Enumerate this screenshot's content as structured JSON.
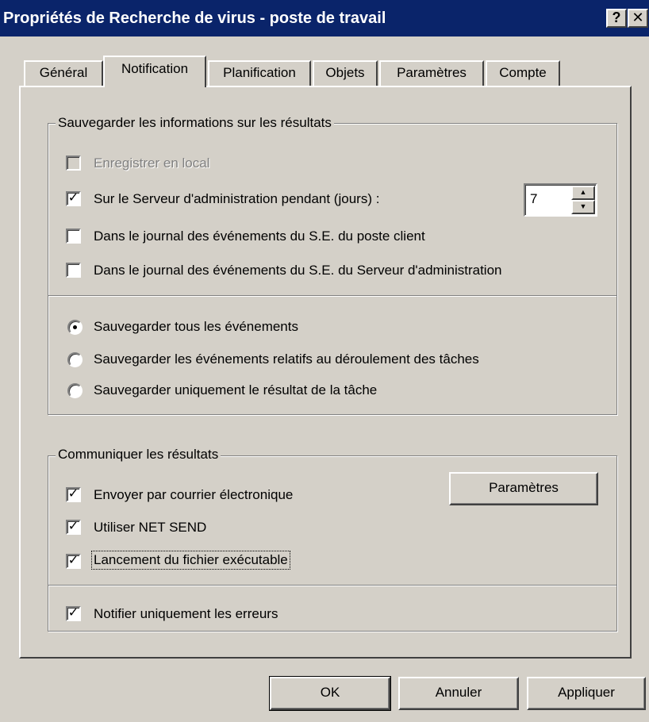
{
  "window": {
    "title": "Propriétés de Recherche de virus - poste de travail",
    "help_label": "?",
    "close_label": "✕"
  },
  "tabs": [
    {
      "label": "Général"
    },
    {
      "label": "Notification"
    },
    {
      "label": "Planification"
    },
    {
      "label": "Objets"
    },
    {
      "label": "Paramètres"
    },
    {
      "label": "Compte"
    }
  ],
  "active_tab": "Notification",
  "save_group": {
    "title": "Sauvegarder les informations sur les résultats",
    "options": [
      {
        "label": "Enregistrer en local",
        "checked": false,
        "disabled": true
      },
      {
        "label": "Sur le Serveur d'administration pendant (jours) :",
        "checked": true,
        "disabled": false
      },
      {
        "label": "Dans le journal des événements du S.E. du poste client",
        "checked": false,
        "disabled": false
      },
      {
        "label": "Dans le journal des événements du S.E. du Serveur d'administration",
        "checked": false,
        "disabled": false
      }
    ],
    "days_value": "7",
    "radios": [
      {
        "label": "Sauvegarder tous les événements",
        "selected": true
      },
      {
        "label": "Sauvegarder les événements relatifs au déroulement des tâches",
        "selected": false
      },
      {
        "label": "Sauvegarder uniquement le résultat de la tâche",
        "selected": false
      }
    ]
  },
  "notify_group": {
    "title": "Communiquer les résultats",
    "options": [
      {
        "label": "Envoyer par courrier électronique",
        "checked": true
      },
      {
        "label": "Utiliser NET SEND",
        "checked": true
      },
      {
        "label": "Lancement du fichier exécutable",
        "checked": true
      }
    ],
    "params_button": "Paramètres",
    "errors_only": {
      "label": "Notifier uniquement les erreurs",
      "checked": true
    }
  },
  "footer": {
    "ok": "OK",
    "cancel": "Annuler",
    "apply": "Appliquer"
  }
}
